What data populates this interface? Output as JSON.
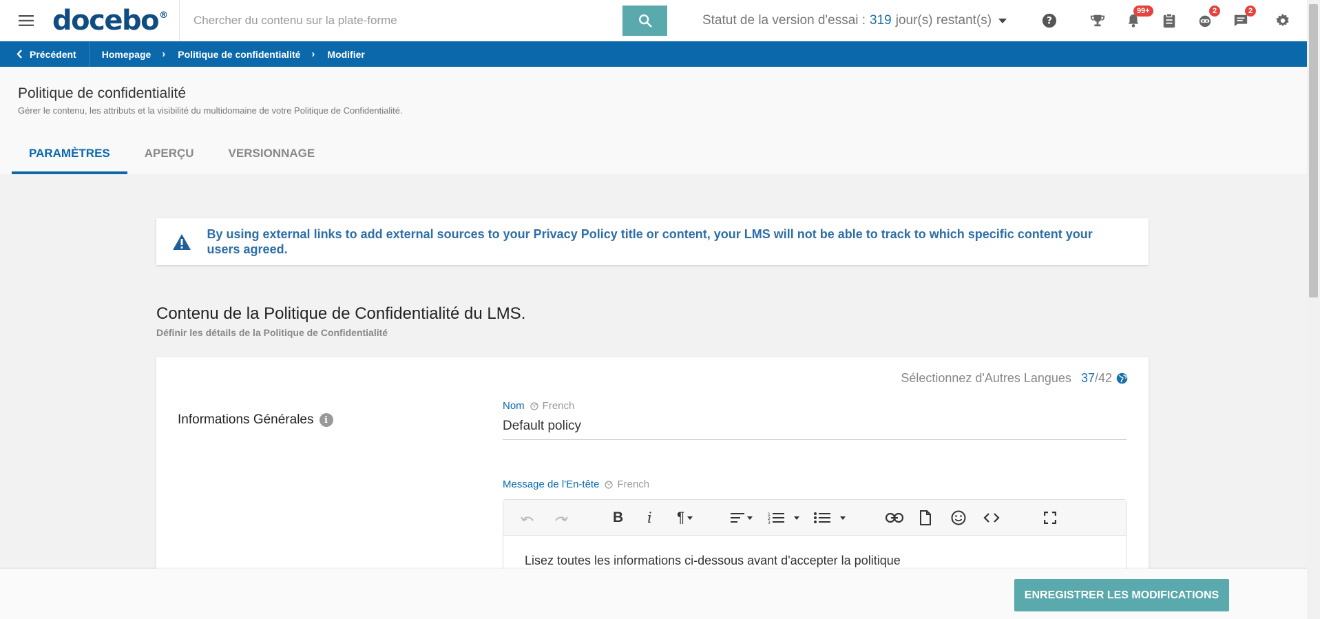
{
  "header": {
    "logo": "docebo",
    "logo_reg": "®",
    "search_placeholder": "Chercher du contenu sur la plate-forme",
    "trial_label": "Statut de la version d'essai :",
    "trial_days": "319",
    "trial_suffix": "jour(s) restant(s)",
    "badges": {
      "notifications": "99+",
      "robot": "2",
      "messages": "2"
    },
    "icons": [
      "hamburger-icon",
      "search-icon",
      "help-icon",
      "trophy-icon",
      "bell-icon",
      "clipboard-icon",
      "robot-icon",
      "chat-icon",
      "gear-icon"
    ]
  },
  "breadcrumb": {
    "back": "Précédent",
    "items": [
      "Homepage",
      "Politique de confidentialité",
      "Modifier"
    ]
  },
  "page": {
    "title": "Politique de confidentialité",
    "subtitle": "Gérer le contenu, les attributs et la visibilité du multidomaine de votre Politique de Confidentialité.",
    "tabs": [
      {
        "label": "PARAMÈTRES",
        "active": true
      },
      {
        "label": "APERÇU",
        "active": false
      },
      {
        "label": "VERSIONNAGE",
        "active": false
      }
    ]
  },
  "warning": {
    "text": "By using external links to add external sources to your Privacy Policy title or content, your LMS will not be able to track to which specific content your users agreed."
  },
  "section": {
    "title": "Contenu de la Politique de Confidentialité du LMS.",
    "subtitle": "Définir les détails de la Politique de Confidentialité"
  },
  "card": {
    "languages_label": "Sélectionnez d'Autres Langues",
    "languages_count": "37",
    "languages_total": "/42",
    "info_label": "Informations Générales",
    "name_label": "Nom",
    "name_lang": "French",
    "name_value": "Default policy",
    "header_msg_label": "Message de l'En-tête",
    "header_msg_lang": "French",
    "editor_text": "Lisez toutes les informations ci-dessous avant d'accepter la politique"
  },
  "footer": {
    "save_label": "ENREGISTRER LES MODIFICATIONS"
  },
  "colors": {
    "primary": "#0a68ab",
    "accent": "#5aa9ac",
    "badge": "#e4433e"
  }
}
